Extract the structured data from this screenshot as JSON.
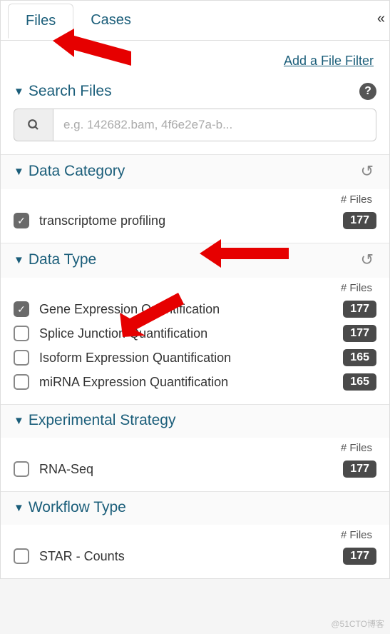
{
  "tabs": {
    "files": "Files",
    "cases": "Cases"
  },
  "addFilter": "Add a File Filter",
  "search": {
    "title": "Search Files",
    "placeholder": "e.g. 142682.bam, 4f6e2e7a-b..."
  },
  "filesHeader": "# Files",
  "facets": {
    "dataCategory": {
      "title": "Data Category",
      "items": [
        {
          "label": "transcriptome profiling",
          "count": "177",
          "checked": true
        }
      ]
    },
    "dataType": {
      "title": "Data Type",
      "items": [
        {
          "label": "Gene Expression Quantification",
          "count": "177",
          "checked": true
        },
        {
          "label": "Splice Junction Quantification",
          "count": "177",
          "checked": false
        },
        {
          "label": "Isoform Expression Quantification",
          "count": "165",
          "checked": false
        },
        {
          "label": "miRNA Expression Quantification",
          "count": "165",
          "checked": false
        }
      ]
    },
    "experimentalStrategy": {
      "title": "Experimental Strategy",
      "items": [
        {
          "label": "RNA-Seq",
          "count": "177",
          "checked": false
        }
      ]
    },
    "workflowType": {
      "title": "Workflow Type",
      "items": [
        {
          "label": "STAR - Counts",
          "count": "177",
          "checked": false
        }
      ]
    }
  },
  "watermark": "@51CTO博客"
}
